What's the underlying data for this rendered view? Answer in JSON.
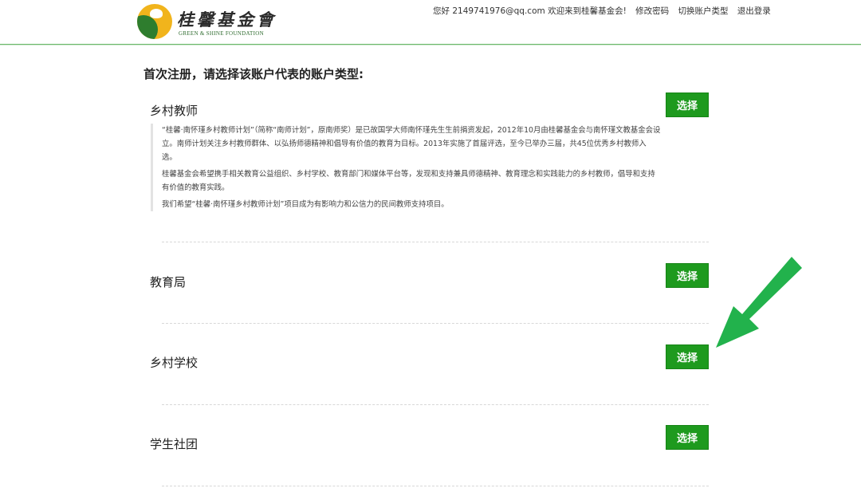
{
  "header": {
    "logo_cn": "桂馨基金會",
    "logo_en": "GREEN & SHINE FOUNDATION",
    "greeting": "您好 2149741976@qq.com 欢迎来到桂馨基金会!",
    "links": [
      "修改密码",
      "切换账户类型",
      "退出登录"
    ]
  },
  "main": {
    "heading": "首次注册，请选择该账户代表的账户类型:",
    "sections": [
      {
        "title": "乡村教师",
        "button": "选择",
        "description": [
          "“桂馨·南怀瑾乡村教师计划”（简称“南师计划”，原南师奖）是已故国学大师南怀瑾先生生前捐资发起，2012年10月由桂馨基金会与南怀瑾文教基金会设立。南师计划关注乡村教师群体、以弘扬师德精神和倡导有价值的教育为目标。2013年实施了首届评选，至今已举办三届，共45位优秀乡村教师入选。",
          "桂馨基金会希望携手相关教育公益组织、乡村学校、教育部门和媒体平台等，发现和支持兼具师德精神、教育理念和实践能力的乡村教师，倡导和支持有价值的教育实践。",
          "我们希望“桂馨·南怀瑾乡村教师计划”项目成为有影响力和公信力的民间教师支持项目。"
        ]
      },
      {
        "title": "教育局",
        "button": "选择"
      },
      {
        "title": "乡村学校",
        "button": "选择"
      },
      {
        "title": "学生社团",
        "button": "选择"
      }
    ]
  },
  "colors": {
    "accent": "#1e9a1e",
    "header_line": "#6bb86a",
    "arrow": "#22b24c"
  }
}
